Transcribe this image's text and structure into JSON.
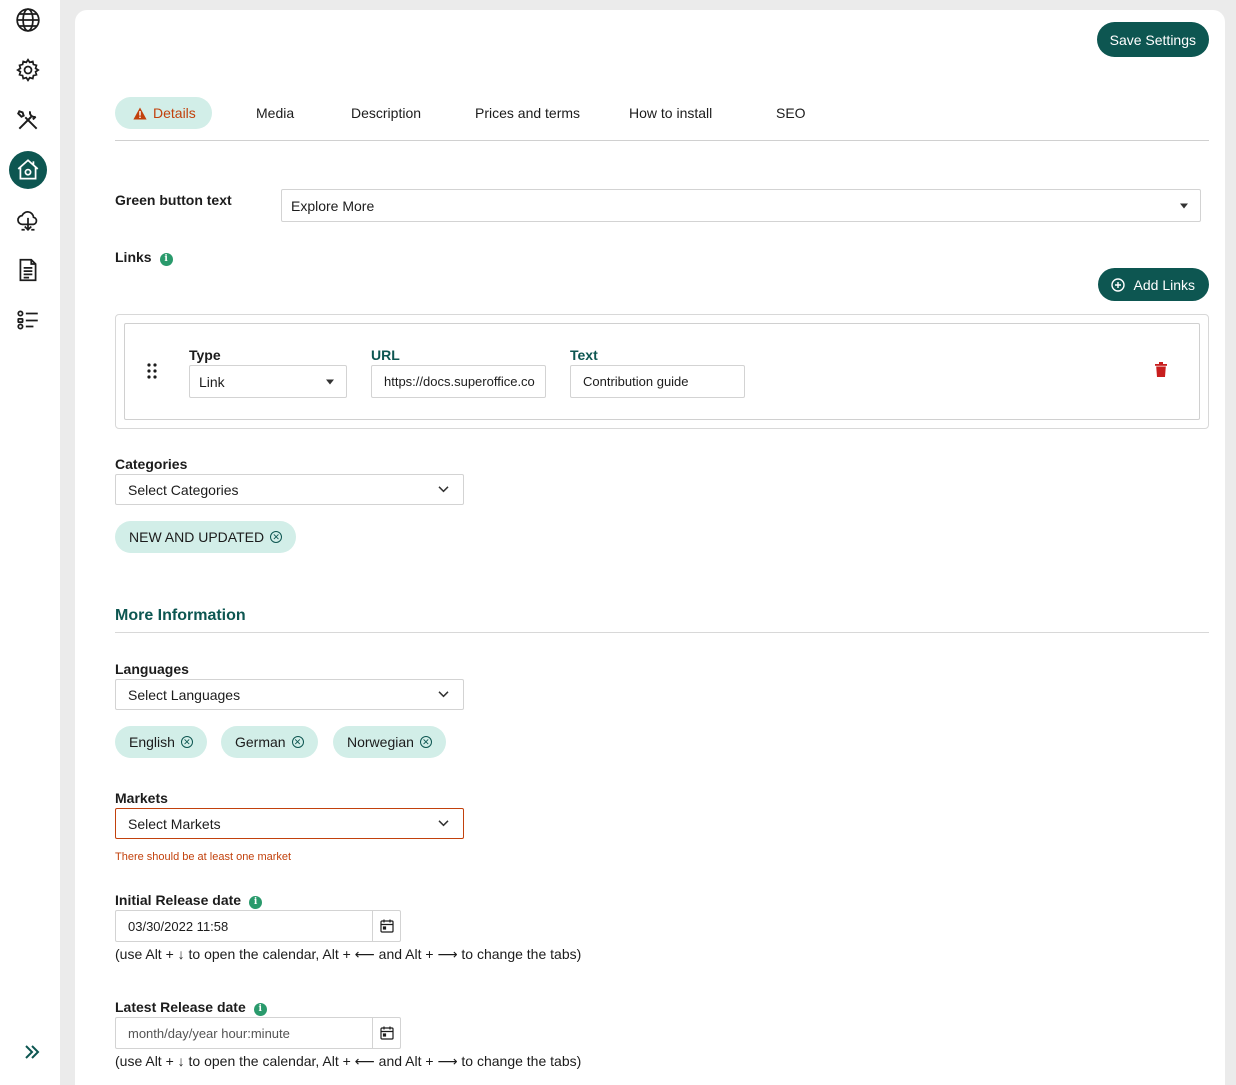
{
  "save_label": "Save Settings",
  "tabs": [
    {
      "label": "Details",
      "active": true
    },
    {
      "label": "Media"
    },
    {
      "label": "Description"
    },
    {
      "label": "Prices and terms"
    },
    {
      "label": "How to install"
    },
    {
      "label": "SEO"
    }
  ],
  "green_button": {
    "label": "Green button text",
    "value": "Explore More"
  },
  "links": {
    "label": "Links",
    "add_label": "Add Links",
    "row": {
      "type_label": "Type",
      "type_value": "Link",
      "url_label": "URL",
      "url_value": "https://docs.superoffice.co",
      "text_label": "Text",
      "text_value": "Contribution guide"
    }
  },
  "categories": {
    "label": "Categories",
    "placeholder": "Select Categories",
    "chips": [
      "NEW AND UPDATED"
    ]
  },
  "more_info_title": "More Information",
  "languages": {
    "label": "Languages",
    "placeholder": "Select Languages",
    "chips": [
      "English",
      "German",
      "Norwegian"
    ]
  },
  "markets": {
    "label": "Markets",
    "placeholder": "Select Markets",
    "error": "There should be at least one market"
  },
  "initial_release": {
    "label": "Initial Release date",
    "value": "03/30/2022 11:58",
    "hint": "(use Alt + ↓ to open the calendar, Alt + ⟵ and Alt + ⟶ to change the tabs)"
  },
  "latest_release": {
    "label": "Latest Release date",
    "placeholder": "month/day/year hour:minute",
    "hint": "(use Alt + ↓ to open the calendar, Alt + ⟵ and Alt + ⟶ to change the tabs)"
  },
  "colors": {
    "accent": "#0d5651",
    "chip": "#d2eee8",
    "warning": "#c2410c",
    "danger": "#c81e1e"
  }
}
